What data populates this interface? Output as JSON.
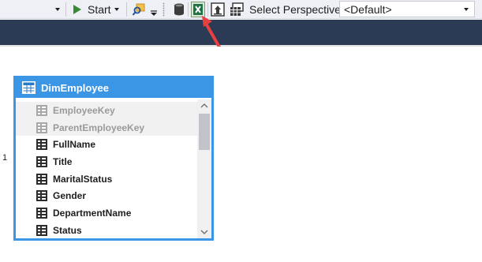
{
  "toolbar": {
    "start_label": "Start",
    "perspective_label": "Select Perspective",
    "perspective_selected": "<Default>",
    "icons": [
      "dropdown-arrow-icon",
      "play-icon",
      "search-icon",
      "overflow-arrow-icon",
      "grip-icon",
      "database-icon",
      "excel-icon",
      "report-icon",
      "perspective-icon"
    ]
  },
  "diagram": {
    "page_number": "1",
    "table": {
      "title": "DimEmployee",
      "columns": [
        {
          "name": "EmployeeKey",
          "hidden": true
        },
        {
          "name": "ParentEmployeeKey",
          "hidden": true
        },
        {
          "name": "FullName",
          "hidden": false
        },
        {
          "name": "Title",
          "hidden": false
        },
        {
          "name": "MaritalStatus",
          "hidden": false
        },
        {
          "name": "Gender",
          "hidden": false
        },
        {
          "name": "DepartmentName",
          "hidden": false
        },
        {
          "name": "Status",
          "hidden": false
        }
      ]
    }
  },
  "annotation": {
    "arrow_color": "#e84040"
  },
  "colors": {
    "accent": "#3b97e6",
    "dark_band": "#2b3b55",
    "toolbar_bg": "#eef0f5"
  }
}
